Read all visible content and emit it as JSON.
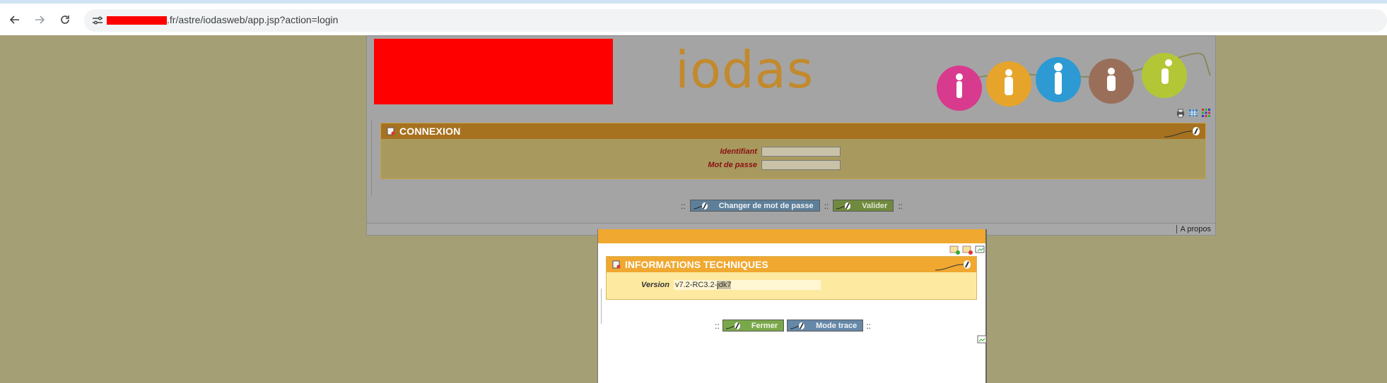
{
  "browser": {
    "url_suffix": ".fr/astre/iodasweb/app.jsp?action=login",
    "icons": {
      "back": "arrow-left-icon",
      "forward": "arrow-right-icon",
      "reload": "reload-icon",
      "site_info": "tune-icon"
    }
  },
  "header": {
    "app_name": "iodas",
    "tools": [
      "print-icon",
      "table-icon",
      "grid-icon"
    ]
  },
  "login": {
    "section_title": "CONNEXION",
    "identifiant_label": "Identifiant",
    "identifiant_value": "",
    "password_label": "Mot de passe",
    "password_value": ""
  },
  "actions": {
    "separator": "::",
    "change_password": "Changer de mot de passe",
    "validate": "Valider"
  },
  "footer": {
    "about": "A propos"
  },
  "popup": {
    "section_title": "INFORMATIONS TECHNIQUES",
    "version_label": "Version",
    "version_prefix": "v7.2-RC3.2-",
    "version_highlight": "jdk7",
    "close": "Fermer",
    "trace_mode": "Mode trace"
  },
  "colors": {
    "page_bg": "#a59f76",
    "app_bg": "#a4a4a4",
    "section_header": "#a67220",
    "popup_header": "#f0a830",
    "brand_text": "#c28a2d",
    "label_red": "#8b1010"
  }
}
